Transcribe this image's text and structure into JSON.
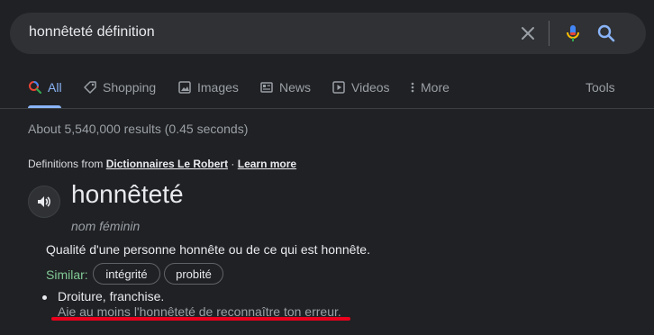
{
  "search": {
    "query": "honnêteté définition"
  },
  "tabs": [
    {
      "label": "All"
    },
    {
      "label": "Shopping"
    },
    {
      "label": "Images"
    },
    {
      "label": "News"
    },
    {
      "label": "Videos"
    },
    {
      "label": "More"
    }
  ],
  "tools_label": "Tools",
  "result_stats": "About 5,540,000 results (0.45 seconds)",
  "definition_source": {
    "prefix": "Definitions from ",
    "source_link": "Dictionnaires Le Robert",
    "separator": " · ",
    "learn_more": "Learn more"
  },
  "entry": {
    "word": "honnêteté",
    "part_of_speech": "nom féminin",
    "definition": "Qualité d'une personne honnête ou de ce qui est honnête.",
    "similar_label": "Similar:",
    "similar": [
      "intégrité",
      "probité"
    ],
    "sub_definition": "Droiture, franchise.",
    "example": "Aie au moins l'honnêteté de reconnaître ton erreur."
  },
  "colors": {
    "accent": "#8ab4f8",
    "similar": "#81c995",
    "annotation": "#e8001c"
  },
  "icons": [
    "clear-icon",
    "mic-icon",
    "search-icon",
    "speaker-icon"
  ]
}
